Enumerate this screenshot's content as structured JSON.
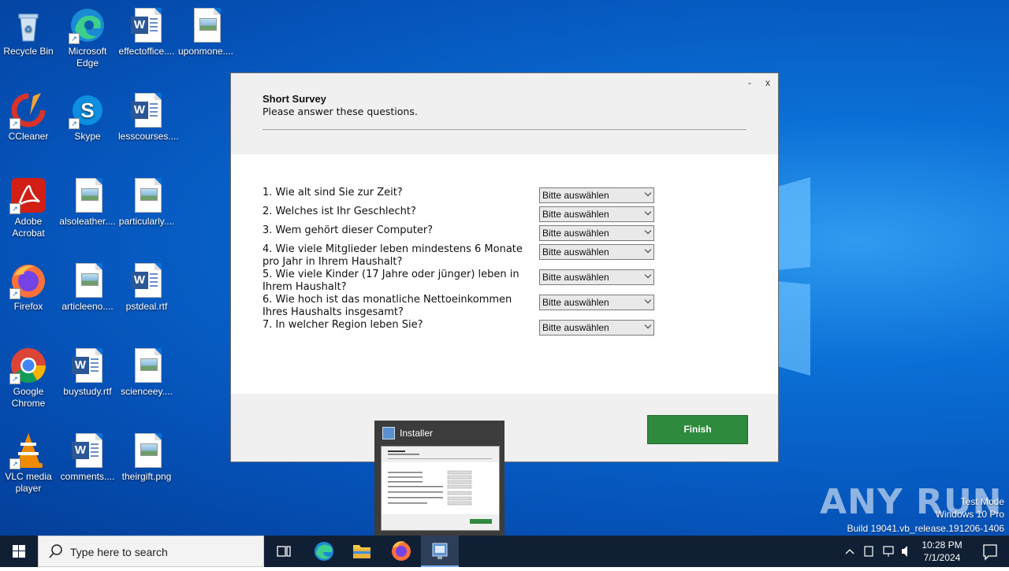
{
  "desktop": {
    "icons": [
      {
        "label": "Recycle Bin",
        "icon": "recycle-bin-icon"
      },
      {
        "label": "Microsoft Edge",
        "icon": "edge-icon"
      },
      {
        "label": "effectoffice....",
        "icon": "word-doc-icon"
      },
      {
        "label": "uponmone....",
        "icon": "image-file-icon"
      },
      {
        "label": "CCleaner",
        "icon": "ccleaner-icon"
      },
      {
        "label": "Skype",
        "icon": "skype-icon"
      },
      {
        "label": "lesscourses....",
        "icon": "word-doc-icon"
      },
      {
        "label": "Adobe Acrobat",
        "icon": "acrobat-icon"
      },
      {
        "label": "alsoleather....",
        "icon": "image-file-icon"
      },
      {
        "label": "particularly....",
        "icon": "image-file-icon"
      },
      {
        "label": "Firefox",
        "icon": "firefox-icon"
      },
      {
        "label": "articleeno....",
        "icon": "image-file-icon"
      },
      {
        "label": "pstdeal.rtf",
        "icon": "word-doc-icon"
      },
      {
        "label": "Google Chrome",
        "icon": "chrome-icon"
      },
      {
        "label": "buystudy.rtf",
        "icon": "word-doc-icon"
      },
      {
        "label": "scienceey....",
        "icon": "image-file-icon"
      },
      {
        "label": "VLC media player",
        "icon": "vlc-icon"
      },
      {
        "label": "comments....",
        "icon": "word-doc-icon"
      },
      {
        "label": "theirgift.png",
        "icon": "image-file-icon"
      }
    ]
  },
  "window": {
    "minimize": "-",
    "close": "x",
    "title": "Short Survey",
    "subtitle": "Please answer these questions.",
    "questions": [
      {
        "text": "1. Wie alt sind Sie zur Zeit?",
        "value": "Bitte auswählen"
      },
      {
        "text": "2. Welches ist Ihr Geschlecht?",
        "value": "Bitte auswählen"
      },
      {
        "text": "3. Wem gehört dieser Computer?",
        "value": "Bitte auswählen"
      },
      {
        "text": "4. Wie viele Mitglieder leben mindestens 6 Monate pro Jahr in Ihrem Haushalt?",
        "value": "Bitte auswählen"
      },
      {
        "text": "5. Wie viele Kinder (17 Jahre oder jünger) leben in Ihrem Haushalt?",
        "value": "Bitte auswählen"
      },
      {
        "text": "6. Wie hoch ist das monatliche Nettoeinkommen Ihres Haushalts insgesamt?",
        "value": "Bitte auswählen"
      },
      {
        "text": "7. In welcher Region leben Sie?",
        "value": "Bitte auswählen"
      }
    ],
    "finish_label": "Finish"
  },
  "preview": {
    "title": "Installer"
  },
  "watermark": {
    "brand": "ANY RUN",
    "line1": "Test Mode",
    "line2": "Windows 10 Pro",
    "line3": "Build 19041.vb_release.191206-1406"
  },
  "taskbar": {
    "search_placeholder": "Type here to search",
    "time": "10:28 PM",
    "date": "7/1/2024"
  }
}
